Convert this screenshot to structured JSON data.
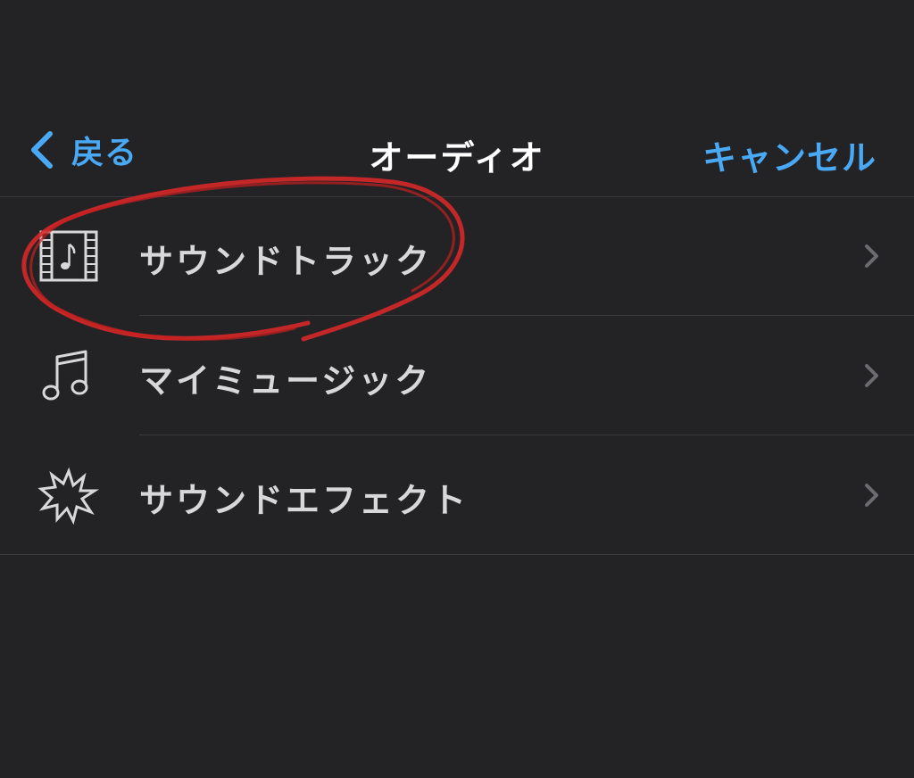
{
  "nav": {
    "back_label": "戻る",
    "title": "オーディオ",
    "cancel_label": "キャンセル"
  },
  "menu": {
    "items": [
      {
        "label": "サウンドトラック",
        "icon": "film-music-icon"
      },
      {
        "label": "マイミュージック",
        "icon": "music-note-icon"
      },
      {
        "label": "サウンドエフェクト",
        "icon": "burst-icon"
      }
    ]
  },
  "colors": {
    "background": "#232325",
    "accent": "#4aa9f5",
    "text": "#d8d8da",
    "title": "#ffffff",
    "divider": "#3a3a3d",
    "annotation": "#d62828"
  }
}
